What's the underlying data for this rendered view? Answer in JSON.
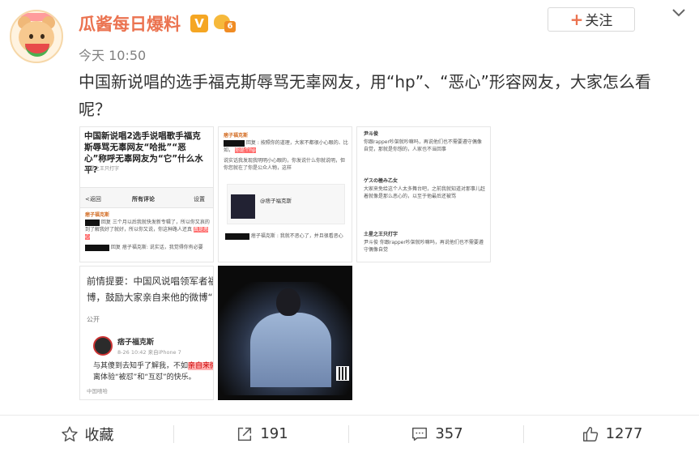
{
  "post": {
    "username": "瓜酱每日爆料",
    "verified_badge": "V",
    "rank_badge": "6",
    "timestamp": "今天 10:50",
    "follow_label": "关注",
    "text_line1": "中国新说唱的选手福克斯辱骂无辜网友，用“hp”、“恶心”形容网友，大家怎么看",
    "text_line2": "呢？"
  },
  "images": {
    "t1": {
      "title": "中国新说唱2选手说唱歌手福克斯辱骂无辜网友“哈批”“恶心”称呼无辜网友为“它”什么水平?",
      "meta": "土星之王只打字",
      "bar_back": "<返回",
      "bar_title": "所有评论",
      "bar_setting": "设置",
      "comment_name": "痞子福克斯",
      "comment_text": "回复 三个月以后我就快发新专辑了，所以你又哀的到了解我好了就好，所以你又说，你这种路人还真",
      "highlight": "真是恶心",
      "reply": "回复 痞子福克斯: 说实话，我觉得你有必要"
    },
    "t2": {
      "name": "痞子福克斯",
      "line1": "回复 : 按照你的道理，大家不都很小心眼的、比如，",
      "highlight": "你是个hp",
      "line2": "说实话我发现我明明小心眼的，你发说什么你就说明，但你您就在了你是公众人物，这样",
      "box_name": "@痞子福克斯",
      "footer": "痞子福克斯 : 我就不恶心了，并且很看恶心"
    },
    "t3": {
      "l1_name": "尹斗俊",
      "l1": "你跟rapper吵架就吵嘛吗，再说他们也不需要遵守偶像自觉，那就是你想的，人家也不当回事",
      "l2_name": "ゲスの極み乙女",
      "l2": "大家来免给这个人太多舞台吧，之前我就知道对那事儿赶着就像是那么恶心的，以至于他最后还被骂",
      "l3_name": "土星之王只打字",
      "l3": "尹斗俊 你跟rapper吵架就吵嘛吗，再说他们也不需要遵守偶像自觉"
    },
    "t4": {
      "line1": "前情提要：中国风说唱领军者福克斯",
      "line2": "博，鼓励大家亲自来他的微博“怼他",
      "public": "公开",
      "name": "痞子福克斯",
      "date": "8-26 10:42 来自iPhone 7",
      "body1": "与其傻到去知乎了解我，不如",
      "body_hl": "亲自来微",
      "body2": "离体验“被怼”和“互怼”的快乐。",
      "footer": "中国嘻哈"
    }
  },
  "actions": {
    "favorite": "收藏",
    "repost": "191",
    "comment": "357",
    "like": "1277"
  },
  "colors": {
    "brand": "#eb7350",
    "text": "#333333",
    "muted": "#808080",
    "border": "#d9d9d9"
  },
  "icons": {
    "favorite": "star-icon",
    "repost": "share-arrow-icon",
    "comment": "comment-icon",
    "like": "thumbs-up-icon",
    "more": "chevron-down-icon"
  }
}
